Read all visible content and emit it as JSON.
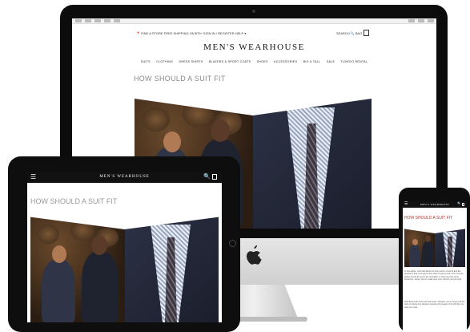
{
  "desktop": {
    "topbar_left": "📍 FIND A STORE   FREE SHIPPING ON $75+   SIGN IN / REGISTER   HELP ▾",
    "topbar_right": "SEARCH  🔍   BAG",
    "logo": "MEN'S WEARHOUSE",
    "nav": [
      "SUITS",
      "CLOTHING",
      "DRESS SHIRTS",
      "BLAZERS & SPORT COATS",
      "SHOES",
      "ACCESSORIES",
      "BIG & TALL",
      "SALE",
      "TUXEDO RENTAL"
    ],
    "page_title": "HOW SHOULD A SUIT FIT"
  },
  "tablet": {
    "menu_icon": "☰",
    "brand": "MEN'S WEARHOUSE",
    "search_icon": "🔍",
    "page_title": "HOW SHOULD A SUIT FIT"
  },
  "phone": {
    "menu_icon": "☰",
    "brand": "MEN'S WEARHOUSE",
    "search_icon": "🔍",
    "page_title": "HOW SHOULD A SUIT FIT",
    "body_text": "In this article, we'll talk about the finer points of suit fit and the questions that most guys have when buying a suit, from how the jacket should fit across the shoulders to how long the pants should be. Here's how to make sure your suit fits you just right.",
    "body_text_2": "Well-fitted suits look and feel better. Whether you're buying off the rack or having one tailored, knowing the basics of fit will help you look your best."
  },
  "colors": {
    "page_title_gray": "#8a8a8a",
    "phone_title_red": "#a33333",
    "device_black": "#0e0e0e"
  }
}
